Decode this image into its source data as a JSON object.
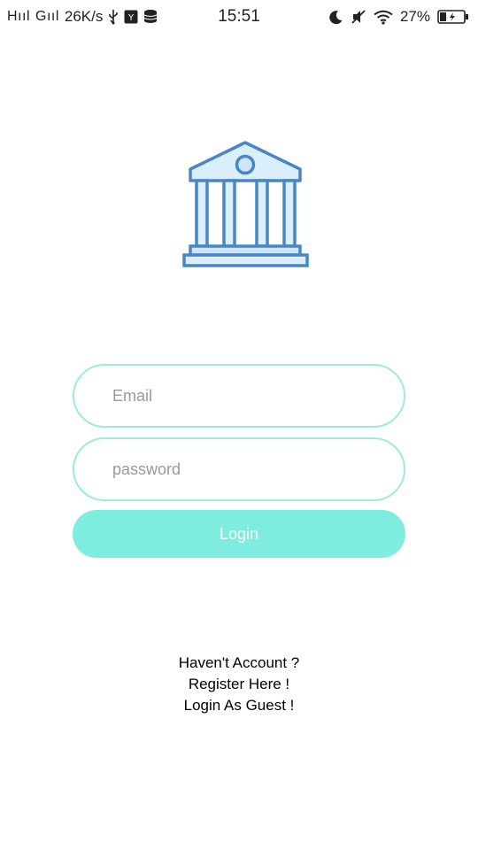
{
  "status_bar": {
    "carrier1": "Hııl",
    "carrier2": "Gııl",
    "speed": "26K/s",
    "time": "15:51",
    "battery_percent": "27%",
    "icons": [
      "usb-icon",
      "app-icon",
      "storage-icon",
      "moon-icon",
      "mute-icon",
      "wifi-icon",
      "battery-icon"
    ]
  },
  "logo": {
    "icon": "bank-icon",
    "stroke_color": "#4a86c4",
    "fill_color": "#dbeefb"
  },
  "form": {
    "email_placeholder": "Email",
    "email_value": "",
    "password_placeholder": "password",
    "password_value": "",
    "login_label": "Login",
    "accent_color": "#7eede0",
    "border_color": "#9fe9e2"
  },
  "links": {
    "no_account": "Haven't Account ?",
    "register": "Register Here !",
    "guest": "Login As Guest !"
  }
}
